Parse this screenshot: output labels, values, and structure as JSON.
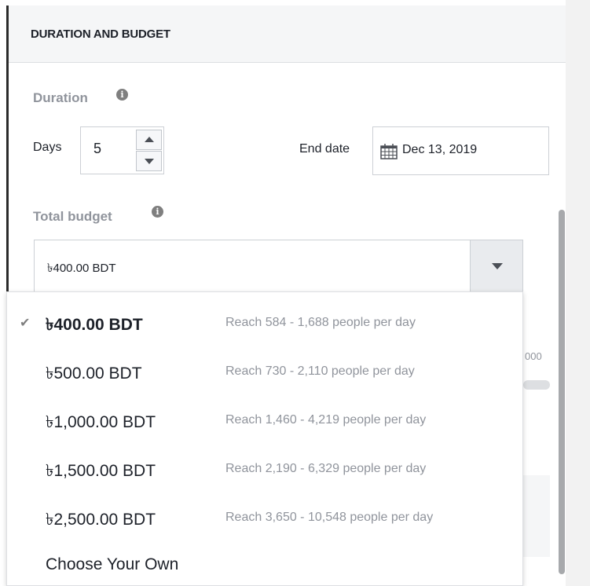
{
  "section": {
    "title": "DURATION AND BUDGET"
  },
  "duration": {
    "label": "Duration",
    "days_label": "Days",
    "days_value": "5",
    "end_date_label": "End date",
    "end_date_value": "Dec 13, 2019"
  },
  "budget": {
    "label": "Total budget",
    "selected": "৳400.00 BDT"
  },
  "background": {
    "scale_fragment": "000"
  },
  "dropdown": {
    "options": [
      {
        "amount": "৳400.00 BDT",
        "reach": "Reach 584 - 1,688 people per day",
        "selected": true,
        "check": "✔"
      },
      {
        "amount": "৳500.00 BDT",
        "reach": "Reach 730 - 2,110 people per day"
      },
      {
        "amount": "৳1,000.00 BDT",
        "reach": "Reach 1,460 - 4,219 people per day"
      },
      {
        "amount": "৳1,500.00 BDT",
        "reach": "Reach 2,190 - 6,329 people per day"
      },
      {
        "amount": "৳2,500.00 BDT",
        "reach": "Reach 3,650 - 10,548 people per day"
      },
      {
        "amount": "Choose Your Own",
        "reach": ""
      }
    ]
  },
  "icons": {
    "info": "info-icon",
    "calendar": "calendar-icon",
    "check": "check-icon",
    "caret": "caret-down-icon",
    "up": "arrow-up-icon",
    "down": "arrow-down-icon"
  },
  "colors": {
    "text": "#1d2129",
    "muted": "#90949c",
    "border": "#ccd0d5",
    "header_bg": "#f5f6f7"
  }
}
